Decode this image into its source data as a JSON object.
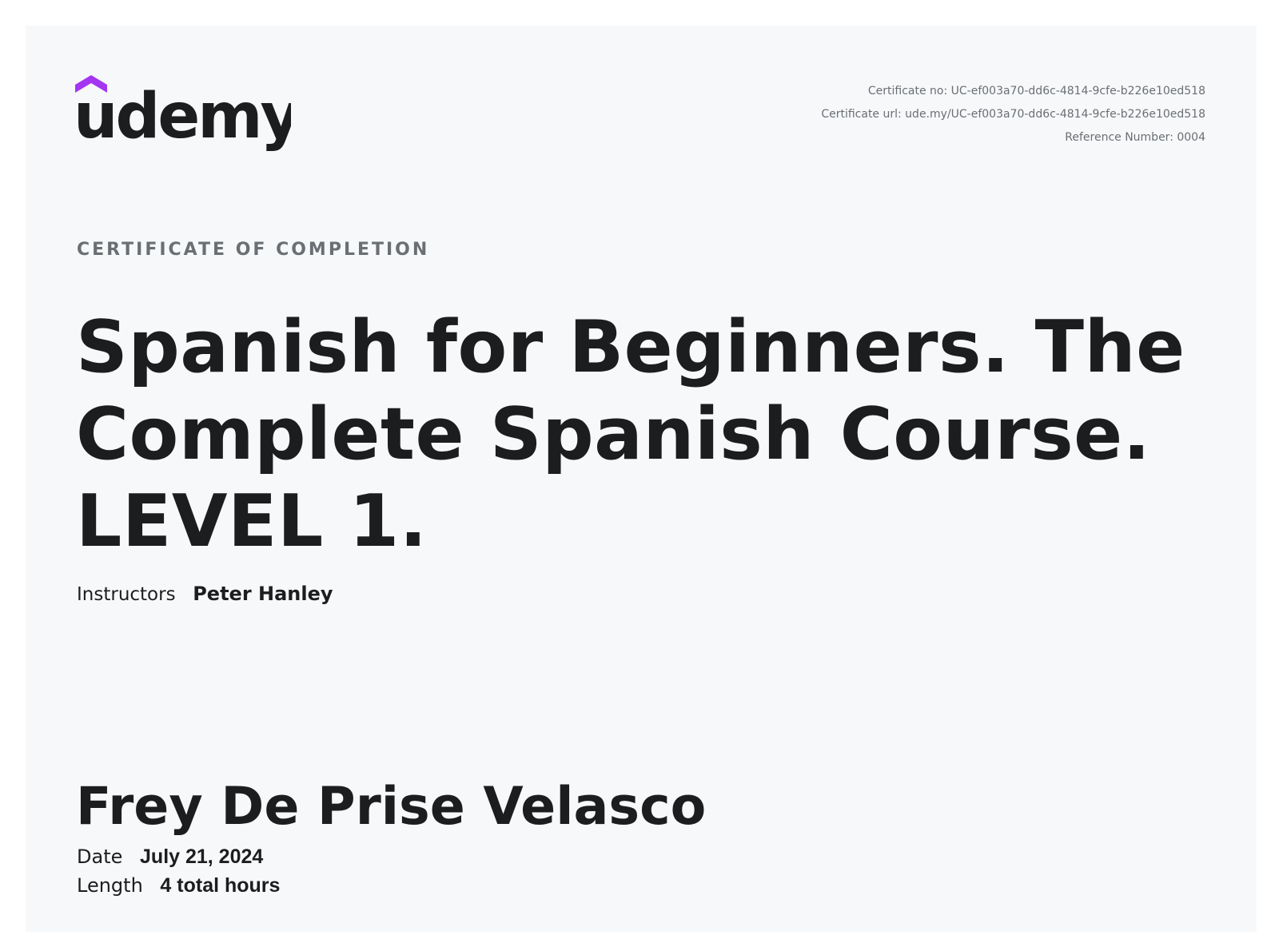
{
  "brand": {
    "logo_text": "udemy",
    "accent_color": "#a435f0",
    "text_color": "#1c1d1f"
  },
  "certificate": {
    "number_line": "Certificate no: UC-ef003a70-dd6c-4814-9cfe-b226e10ed518",
    "url_line": "Certificate url: ude.my/UC-ef003a70-dd6c-4814-9cfe-b226e10ed518",
    "reference_line": "Reference Number: 0004",
    "kicker": "CERTIFICATE OF COMPLETION",
    "course_title": "Spanish for Beginners. The Complete Spanish Course. LEVEL 1.",
    "instructors_label": "Instructors",
    "instructors_value": "Peter Hanley",
    "recipient": "Frey De Prise Velasco",
    "date_label": "Date",
    "date_value": "July 21, 2024",
    "length_label": "Length",
    "length_value": "4 total hours"
  }
}
